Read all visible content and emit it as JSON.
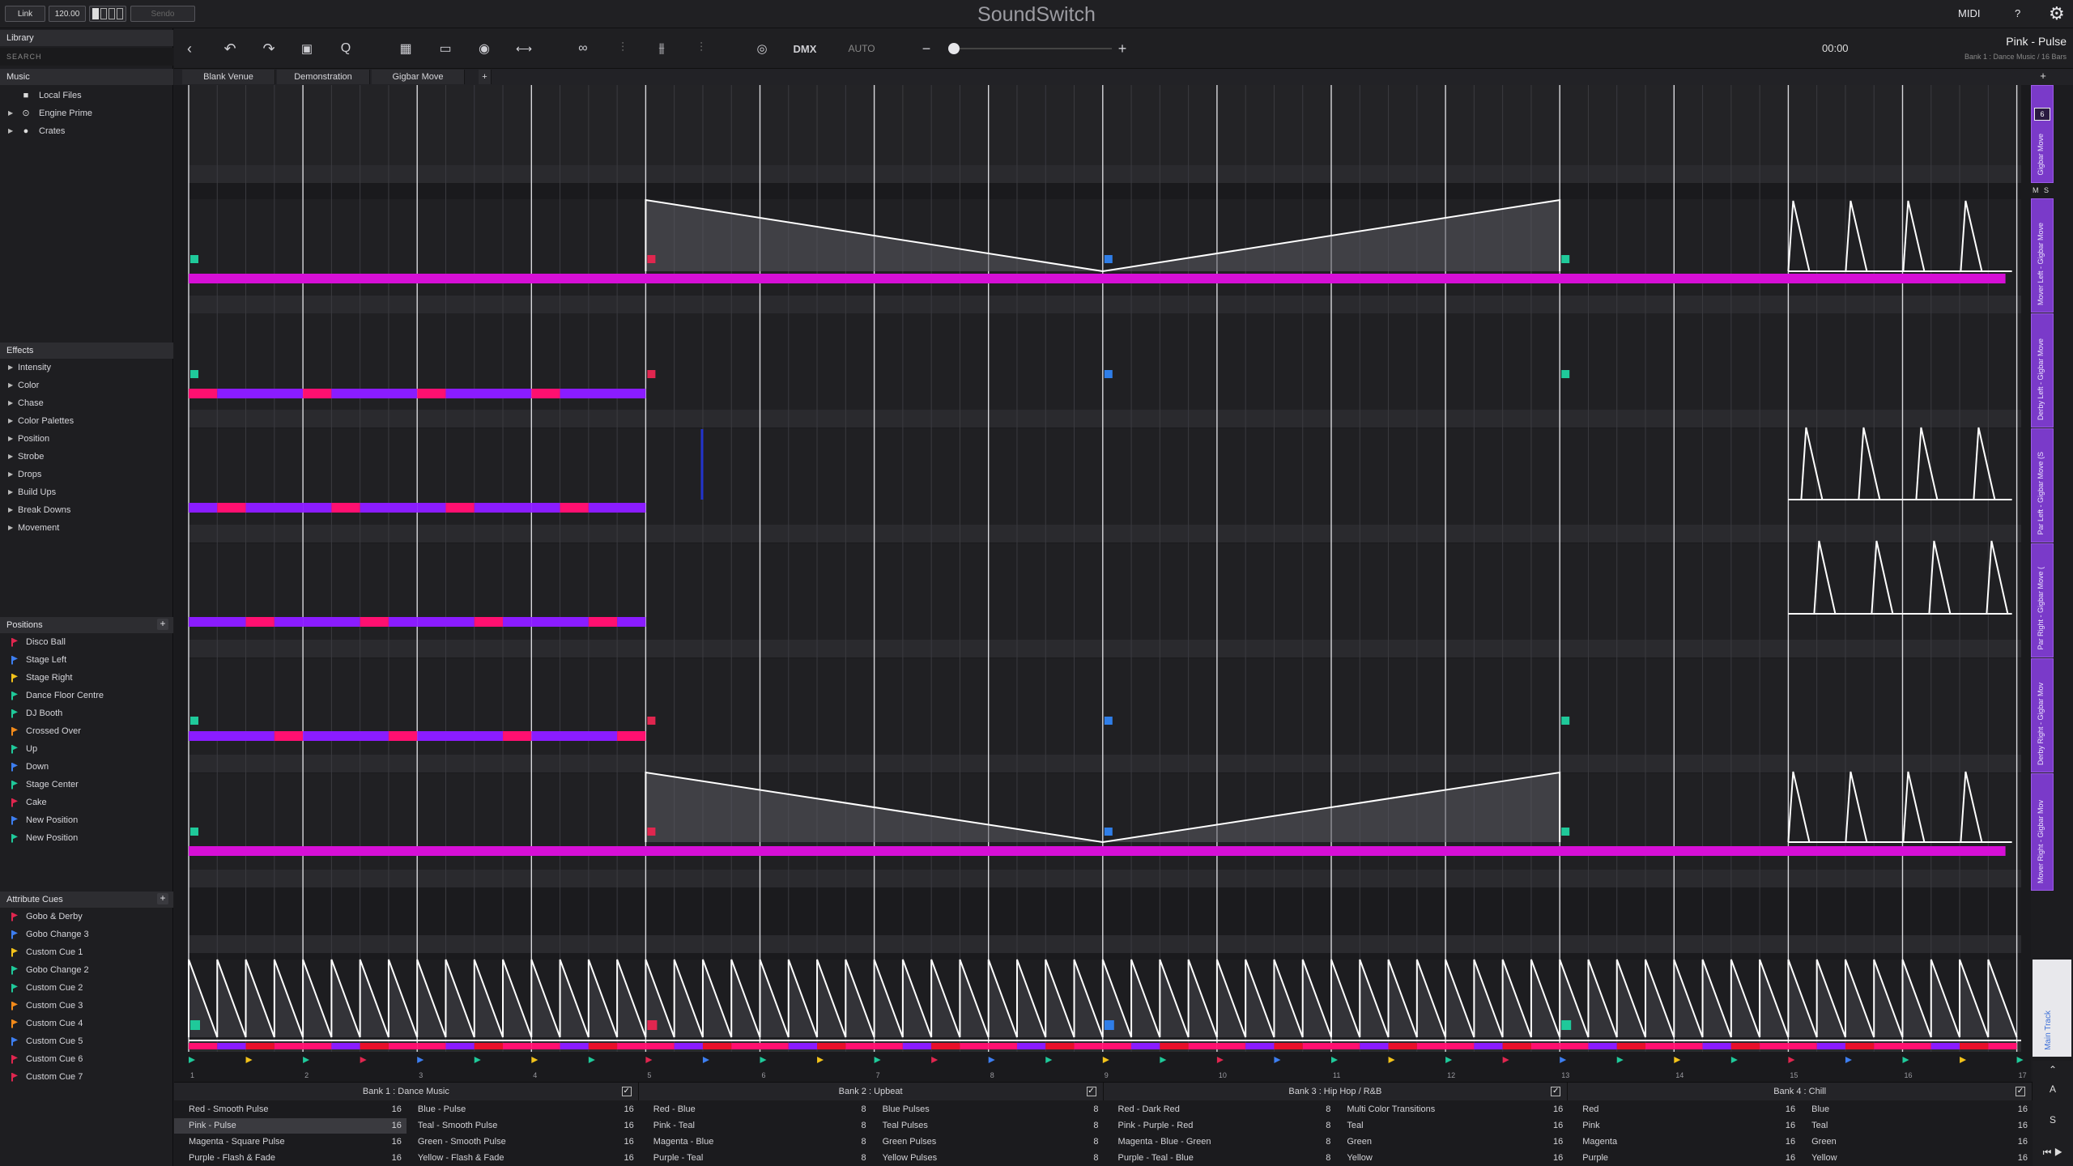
{
  "app": {
    "title": "SoundSwitch"
  },
  "topbar": {
    "link": "Link",
    "bpm": "120.00",
    "sendo": "Sendo",
    "midi": "MIDI",
    "help": "?"
  },
  "track": {
    "title": "Pink - Pulse",
    "subtitle": "Bank 1 : Dance Music / 16 Bars",
    "time": "00:00"
  },
  "toolbar": {
    "dmx": "DMX",
    "auto": "AUTO"
  },
  "venue_tabs": [
    "Blank Venue",
    "Demonstration",
    "Gigbar Move"
  ],
  "library": {
    "header": "Library",
    "search_placeholder": "SEARCH",
    "music_header": "Music",
    "music_items": [
      "Local Files",
      "Engine Prime",
      "Crates"
    ]
  },
  "effects": {
    "header": "Effects",
    "items": [
      "Intensity",
      "Color",
      "Chase",
      "Color Palettes",
      "Position",
      "Strobe",
      "Drops",
      "Build Ups",
      "Break Downs",
      "Movement"
    ]
  },
  "positions": {
    "header": "Positions",
    "items": [
      {
        "label": "Disco Ball",
        "color": "#e0264f"
      },
      {
        "label": "Stage Left",
        "color": "#3d7ef0"
      },
      {
        "label": "Stage Right",
        "color": "#f2c21a"
      },
      {
        "label": "Dance Floor Centre",
        "color": "#1fc99a"
      },
      {
        "label": "DJ Booth",
        "color": "#1fc99a"
      },
      {
        "label": "Crossed Over",
        "color": "#f28a1a"
      },
      {
        "label": "Up",
        "color": "#1fc99a"
      },
      {
        "label": "Down",
        "color": "#3d7ef0"
      },
      {
        "label": "Stage Center",
        "color": "#1fc99a"
      },
      {
        "label": "Cake",
        "color": "#e0264f"
      },
      {
        "label": "New Position",
        "color": "#3d7ef0"
      },
      {
        "label": "New Position",
        "color": "#1fc99a"
      }
    ]
  },
  "attribute_cues": {
    "header": "Attribute Cues",
    "items": [
      {
        "label": "Gobo &  Derby",
        "color": "#e0264f"
      },
      {
        "label": "Gobo Change 3",
        "color": "#3d7ef0"
      },
      {
        "label": "Custom Cue 1",
        "color": "#f2c21a"
      },
      {
        "label": "Gobo Change 2",
        "color": "#1fc99a"
      },
      {
        "label": "Custom Cue 2",
        "color": "#1fc99a"
      },
      {
        "label": "Custom Cue 3",
        "color": "#f28a1a"
      },
      {
        "label": "Custom Cue 4",
        "color": "#f28a1a"
      },
      {
        "label": "Custom Cue 5",
        "color": "#3d7ef0"
      },
      {
        "label": "Custom Cue 6",
        "color": "#e0264f"
      },
      {
        "label": "Custom Cue 7",
        "color": "#e0264f"
      }
    ]
  },
  "rail_tracks": [
    "Gigbar Move",
    "Mover Left - Gigbar Move",
    "Derby Left - Gigbar Move",
    "Par Left - Gigbar Move (S",
    "Par Right - Gigbar Move (",
    "Derby Right - Gigbar Mov",
    "Mover Right - Gigbar Mov"
  ],
  "rail_chip": "6",
  "main_track": "Main Track",
  "banks": [
    {
      "title": "Bank 1 : Dance Music",
      "cues": [
        {
          "label": "Red - Smooth Pulse",
          "n": "16"
        },
        {
          "label": "Blue - Pulse",
          "n": "16"
        },
        {
          "label": "Pink - Pulse",
          "n": "16"
        },
        {
          "label": "Teal - Smooth Pulse",
          "n": "16"
        },
        {
          "label": "Magenta - Square Pulse",
          "n": "16"
        },
        {
          "label": "Green - Smooth Pulse",
          "n": "16"
        },
        {
          "label": "Purple - Flash & Fade",
          "n": "16"
        },
        {
          "label": "Yellow - Flash & Fade",
          "n": "16"
        }
      ]
    },
    {
      "title": "Bank 2 : Upbeat",
      "cues": [
        {
          "label": "Red - Blue",
          "n": "8"
        },
        {
          "label": "Blue Pulses",
          "n": "8"
        },
        {
          "label": "Pink - Teal",
          "n": "8"
        },
        {
          "label": "Teal Pulses",
          "n": "8"
        },
        {
          "label": "Magenta - Blue",
          "n": "8"
        },
        {
          "label": "Green Pulses",
          "n": "8"
        },
        {
          "label": "Purple - Teal",
          "n": "8"
        },
        {
          "label": "Yellow Pulses",
          "n": "8"
        }
      ]
    },
    {
      "title": "Bank 3 : Hip Hop / R&B",
      "cues": [
        {
          "label": "Red - Dark Red",
          "n": "8"
        },
        {
          "label": "Multi Color Transitions",
          "n": "16"
        },
        {
          "label": "Pink - Purple - Red",
          "n": "8"
        },
        {
          "label": "Teal",
          "n": "16"
        },
        {
          "label": "Magenta - Blue - Green",
          "n": "8"
        },
        {
          "label": "Green",
          "n": "16"
        },
        {
          "label": "Purple - Teal - Blue",
          "n": "8"
        },
        {
          "label": "Yellow",
          "n": "16"
        }
      ]
    },
    {
      "title": "Bank 4 : Chill",
      "cues": [
        {
          "label": "Red",
          "n": "16"
        },
        {
          "label": "Blue",
          "n": "16"
        },
        {
          "label": "Pink",
          "n": "16"
        },
        {
          "label": "Teal",
          "n": "16"
        },
        {
          "label": "Magenta",
          "n": "16"
        },
        {
          "label": "Green",
          "n": "16"
        },
        {
          "label": "Purple",
          "n": "16"
        },
        {
          "label": "Yellow",
          "n": "16"
        }
      ]
    }
  ],
  "bar_numbers": [
    "1",
    "2",
    "3",
    "4",
    "5",
    "6",
    "7",
    "8",
    "9",
    "10",
    "11",
    "12",
    "13",
    "14",
    "15",
    "16",
    "17"
  ],
  "side_buttons": {
    "a": "A",
    "s": "S",
    "m": "M",
    "s2": "S"
  },
  "colors": {
    "magenta": "#d60fd6",
    "purple": "#8a1cff",
    "pink": "#ff1070",
    "red": "#e8102a",
    "accent": "#8a3fd8"
  }
}
